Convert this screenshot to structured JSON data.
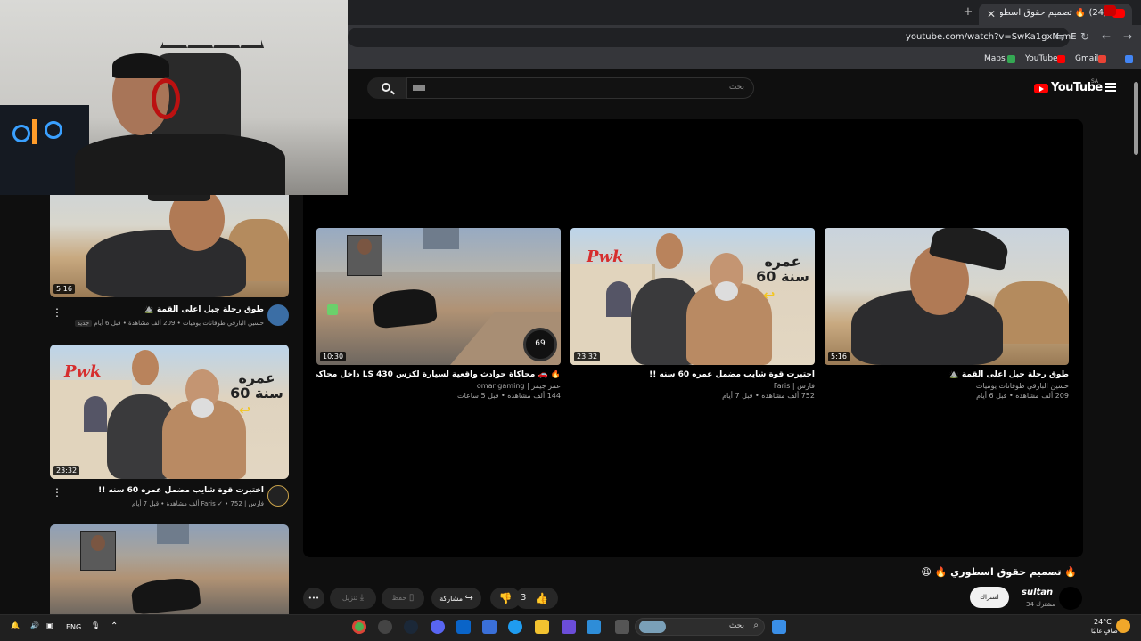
{
  "browser": {
    "tab_title": "(24) 🔥 تصميم حقوق اسطوري",
    "tab_close": "✕",
    "new_tab": "+",
    "url": "youtube.com/watch?v=SwKa1gxN-mE",
    "bookmarks": [
      {
        "label": "Gmail",
        "icon": "gmail-icon",
        "color": "#ea4335"
      },
      {
        "label": "YouTube",
        "icon": "youtube-icon",
        "color": "#ff0000"
      },
      {
        "label": "Maps",
        "icon": "maps-icon",
        "color": "#34a853"
      }
    ]
  },
  "youtube": {
    "logo_text": "YouTube",
    "region": "SA",
    "search_placeholder": "بحث"
  },
  "end_screen": [
    {
      "title": "🔥 🚗 محاكاة حوادث واقعية لسيارة لكزس LS 430 داخل محاكي الحوادث",
      "channel": "عمر جيمر | omar gaming",
      "meta": "144 ألف مشاهدة • قبل 5 ساعات",
      "duration": "10:30",
      "thumb_style": "game"
    },
    {
      "title": "اختبرت قوة شايب مضمل عمره 60 سنه !!",
      "channel": "فارس | Faris",
      "meta": "752 ألف مشاهدة • قبل 7 أيام",
      "duration": "23:32",
      "thumb_style": "bldg",
      "overlay_text": "عمره\n60 سنة"
    },
    {
      "title": "طوق رحلة جبل اعلى القمة ⛰️",
      "channel": "حسين البارقي طوفانات يوميات",
      "meta": "209 ألف مشاهدة • قبل 6 أيام",
      "duration": "5:16",
      "thumb_style": "desert"
    }
  ],
  "sidebar": [
    {
      "title": "طوق رحلة جبل اعلى القمة ⛰️",
      "sub": "حسين البارقي طوفانات يوميات • 209 ألف مشاهدة • قبل 6 أيام",
      "badge": "جديد",
      "duration": "5:16"
    },
    {
      "title": "اختبرت قوة شايب مضمل عمره 60 سنه !!",
      "sub": "فارس | Faris ✓ • 752 ألف مشاهدة • قبل 7 أيام",
      "duration": "23:32",
      "overlay_text": "عمره\n60 سنة"
    },
    {
      "title": "",
      "duration": ""
    }
  ],
  "video": {
    "title": "🔥 تصميم حقوق اسطوري 🔥 😩",
    "channel": "sultan",
    "subscribers": "34 مشترك",
    "subscribe_label": "اشتراك",
    "likes": "3",
    "share_label": "مشاركة",
    "save_label": "حفظ",
    "download_label": "تنزيل",
    "more_label": "•••"
  },
  "taskbar": {
    "lang": "ENG",
    "search_placeholder": "بحث",
    "weather_temp": "24°C",
    "weather_desc": "صافٍ غالبًا"
  },
  "colors": {
    "accent": "#ff0000",
    "bg": "#0f0f0f"
  }
}
